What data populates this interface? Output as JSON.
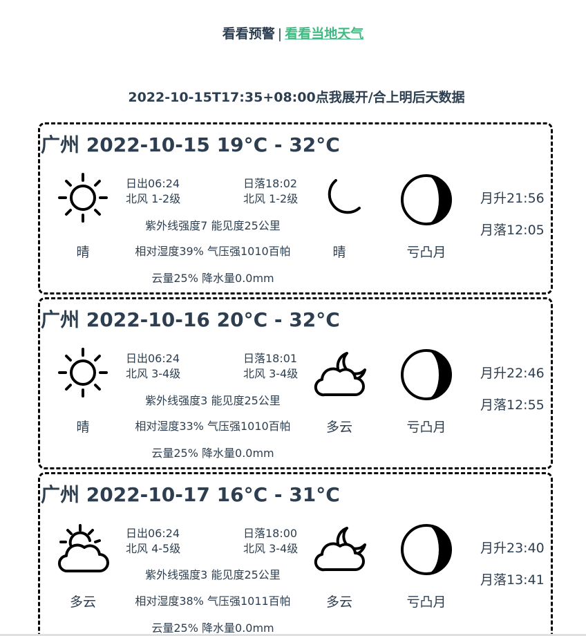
{
  "nav": {
    "warn_link": "看看预警",
    "separator": "|",
    "local_link": "看看当地天气"
  },
  "toggle_text": "2022-10-15T17:35+08:00点我展开/合上明后天数据",
  "days": [
    {
      "title": "广州 2022-10-15 19°C - 32°C",
      "day_icon": "sun-icon",
      "day_text": "晴",
      "sunrise": "日出06:24",
      "sunset": "日落18:02",
      "wind_day": "北风 1-2级",
      "wind_night": "北风 1-2级",
      "uv_vis": "紫外线强度7 能见度25公里",
      "humidity_pressure": "相对湿度39% 气压强1010百帕",
      "cloud_precip": "云量25% 降水量0.0mm",
      "night_icon": "moon-icon",
      "night_text": "晴",
      "moon_phase_icon": "waning-gibbous-icon",
      "moon_phase": "亏凸月",
      "moonrise": "月升21:56",
      "moonset": "月落12:05"
    },
    {
      "title": "广州 2022-10-16 20°C - 32°C",
      "day_icon": "sun-icon",
      "day_text": "晴",
      "sunrise": "日出06:24",
      "sunset": "日落18:01",
      "wind_day": "北风 3-4级",
      "wind_night": "北风 3-4级",
      "uv_vis": "紫外线强度3 能见度25公里",
      "humidity_pressure": "相对湿度33% 气压强1010百帕",
      "cloud_precip": "云量25% 降水量0.0mm",
      "night_icon": "cloudy-night-icon",
      "night_text": "多云",
      "moon_phase_icon": "waning-gibbous-icon",
      "moon_phase": "亏凸月",
      "moonrise": "月升22:46",
      "moonset": "月落12:55"
    },
    {
      "title": "广州 2022-10-17 16°C - 31°C",
      "day_icon": "cloudy-day-icon",
      "day_text": "多云",
      "sunrise": "日出06:24",
      "sunset": "日落18:00",
      "wind_day": "北风 4-5级",
      "wind_night": "北风 3-4级",
      "uv_vis": "紫外线强度3 能见度25公里",
      "humidity_pressure": "相对湿度38% 气压强1011百帕",
      "cloud_precip": "云量25% 降水量0.0mm",
      "night_icon": "cloudy-night-icon",
      "night_text": "多云",
      "moon_phase_icon": "waning-gibbous-icon",
      "moon_phase": "亏凸月",
      "moonrise": "月升23:40",
      "moonset": "月落13:41"
    }
  ]
}
